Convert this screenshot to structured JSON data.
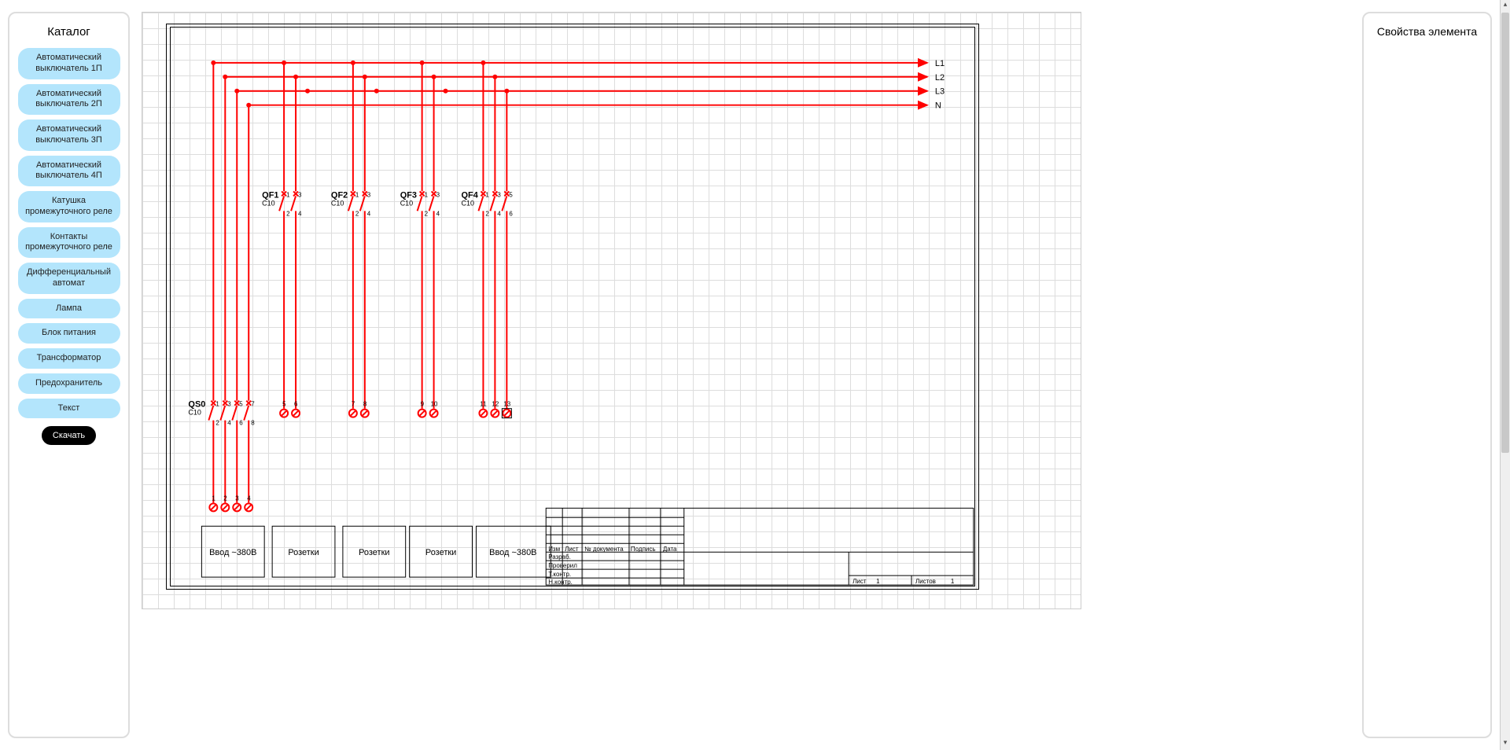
{
  "sidebar": {
    "title": "Каталог",
    "items": [
      "Автоматический выключатель 1П",
      "Автоматический выключатель 2П",
      "Автоматический выключатель 3П",
      "Автоматический выключатель 4П",
      "Катушка промежуточного реле",
      "Контакты промежуточного реле",
      "Дифференциальный автомат",
      "Лампа",
      "Блок питания",
      "Трансформатор",
      "Предохранитель",
      "Текст"
    ],
    "download": "Скачать"
  },
  "right": {
    "title": "Свойства элемента"
  },
  "buses": [
    "L1",
    "L2",
    "L3",
    "N"
  ],
  "devices": {
    "qs0": {
      "name": "QS0",
      "sub": "C10",
      "top": [
        "1",
        "3",
        "5",
        "7"
      ],
      "bottom": [
        "2",
        "4",
        "6",
        "8"
      ]
    },
    "qf1": {
      "name": "QF1",
      "sub": "C10",
      "top": [
        "1",
        "3"
      ],
      "bottom": [
        "2",
        "4"
      ]
    },
    "qf2": {
      "name": "QF2",
      "sub": "C10",
      "top": [
        "1",
        "3"
      ],
      "bottom": [
        "2",
        "4"
      ]
    },
    "qf3": {
      "name": "QF3",
      "sub": "C10",
      "top": [
        "1",
        "3"
      ],
      "bottom": [
        "2",
        "4"
      ]
    },
    "qf4": {
      "name": "QF4",
      "sub": "C10",
      "top": [
        "1",
        "3",
        "5"
      ],
      "bottom": [
        "2",
        "4",
        "6"
      ]
    }
  },
  "terminals_qs0_in": [
    "1",
    "2",
    "3",
    "4"
  ],
  "terminals_out": {
    "qf1": [
      "5",
      "6"
    ],
    "qf2": [
      "7",
      "8"
    ],
    "qf3": [
      "9",
      "10"
    ],
    "qf4": [
      "11",
      "12",
      "13"
    ]
  },
  "boxes": [
    "Ввод ~380В",
    "Розетки",
    "Розетки",
    "Розетки",
    "Ввод ~380В"
  ],
  "titleblock": {
    "headers": [
      "Изм",
      "Лист",
      "№ документа",
      "Подпись",
      "Дата"
    ],
    "rows": [
      "Разраб.",
      "Проверил",
      "Т.контр.",
      "Н.контр."
    ],
    "sheet": "Лист",
    "sheet_val": "1",
    "sheets": "Листов",
    "sheets_val": "1"
  }
}
